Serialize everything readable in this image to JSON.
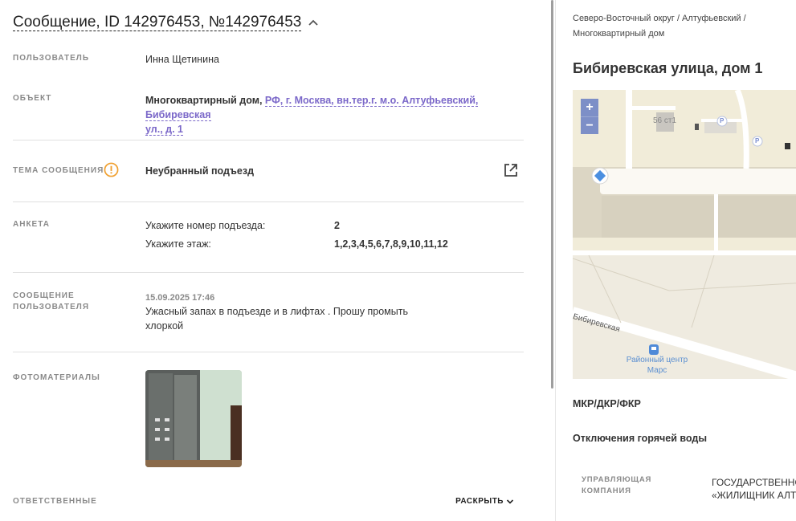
{
  "header": {
    "title": "Сообщение, ID 142976453, №142976453"
  },
  "fields": {
    "user": {
      "label": "ПОЛЬЗОВАТЕЛЬ",
      "value": "Инна Щетинина"
    },
    "object": {
      "label": "ОБЪЕКТ",
      "type": "Многоквартирный дом,",
      "address_line1": "РФ, г. Москва, вн.тер.г. м.о. Алтуфьевский, Бибиревская",
      "address_line2": "ул., д. 1"
    },
    "topic": {
      "label": "ТЕМА СООБЩЕНИЯ",
      "value": "Неубранный подъезд"
    },
    "survey": {
      "label": "АНКЕТА",
      "rows": [
        {
          "question": "Укажите номер подъезда:",
          "answer": "2"
        },
        {
          "question": "Укажите этаж:",
          "answer": "1,2,3,4,5,6,7,8,9,10,11,12"
        }
      ]
    },
    "message": {
      "label_line1": "СООБЩЕНИЕ",
      "label_line2": "ПОЛЬЗОВАТЕЛЯ",
      "datetime": "15.09.2025 17:46",
      "text_line1": "Ужасный запах в подъезде и в лифтах . Прошу промыть",
      "text_line2": "хлоркой"
    },
    "photos": {
      "label": "ФОТОМАТЕРИАЛЫ"
    },
    "responsible": {
      "label": "ОТВЕТСТВЕННЫЕ",
      "expand_label": "РАСКРЫТЬ"
    }
  },
  "right": {
    "breadcrumbs_line1": "Северо-Восточный округ / Алтуфьевский /",
    "breadcrumbs_line2": "Многоквартирный дом",
    "address": "Бибиревская улица, дом 1",
    "map": {
      "zoom_in": "+",
      "zoom_out": "−",
      "building_label": "56 ст1",
      "parking": "P",
      "street_label": "Бибиревская",
      "poi_line1": "Районный центр",
      "poi_line2": "Марс"
    },
    "programs": "МКР/ДКР/ФКР",
    "hot_water": "Отключения горячей воды",
    "management": {
      "label_line1": "УПРАВЛЯЮЩАЯ",
      "label_line2": "КОМПАНИЯ",
      "value_line1": "ГОСУДАРСТВЕННО",
      "value_line2": "«ЖИЛИЩНИК АЛТ"
    }
  },
  "colors": {
    "link": "#7b68c9",
    "warning": "#f0a030",
    "map_bg": "#f1ecd9",
    "zoom_btn": "#7d8fc7"
  }
}
